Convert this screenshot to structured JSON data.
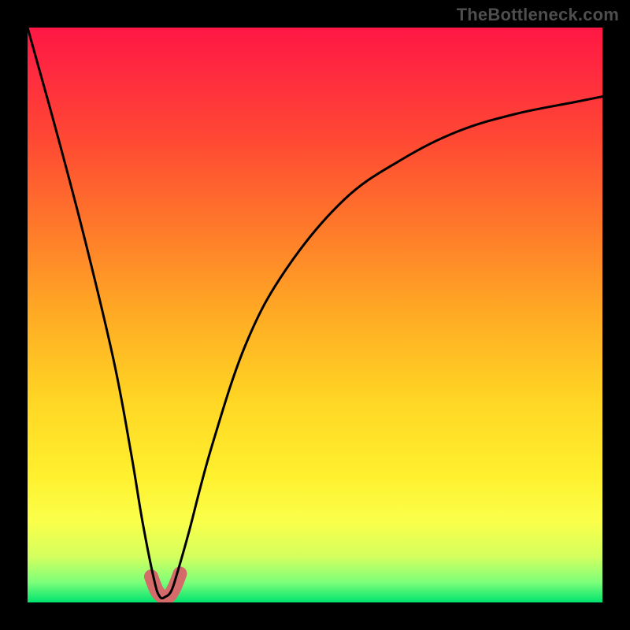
{
  "watermark": "TheBottleneck.com",
  "chart_data": {
    "type": "line",
    "title": "",
    "xlabel": "",
    "ylabel": "",
    "xlim": [
      0,
      100
    ],
    "ylim": [
      0,
      100
    ],
    "series": [
      {
        "name": "bottleneck-curve",
        "x": [
          0,
          5,
          10,
          15,
          18,
          20,
          22,
          23,
          24,
          25,
          26,
          28,
          32,
          38,
          45,
          55,
          65,
          75,
          85,
          95,
          100
        ],
        "values": [
          100,
          82,
          63,
          42,
          26,
          14,
          4,
          1,
          1,
          2,
          5,
          12,
          27,
          45,
          58,
          70,
          77,
          82,
          85,
          87,
          88
        ]
      },
      {
        "name": "highlight-region",
        "x": [
          21.5,
          22.5,
          23.5,
          24.5,
          25.5,
          26.5
        ],
        "values": [
          4.5,
          2.0,
          1.0,
          1.0,
          2.5,
          5.0
        ]
      }
    ],
    "gradient_stops": [
      {
        "offset": 0.0,
        "color": "#ff1744"
      },
      {
        "offset": 0.08,
        "color": "#ff2b3f"
      },
      {
        "offset": 0.2,
        "color": "#ff4a33"
      },
      {
        "offset": 0.35,
        "color": "#ff7a2a"
      },
      {
        "offset": 0.5,
        "color": "#ffab24"
      },
      {
        "offset": 0.65,
        "color": "#ffd624"
      },
      {
        "offset": 0.78,
        "color": "#fff02e"
      },
      {
        "offset": 0.86,
        "color": "#faff4a"
      },
      {
        "offset": 0.92,
        "color": "#d4ff5e"
      },
      {
        "offset": 0.965,
        "color": "#7dff7a"
      },
      {
        "offset": 1.0,
        "color": "#00e36e"
      }
    ],
    "highlight_color": "#d46a6a",
    "curve_color": "#000000"
  }
}
